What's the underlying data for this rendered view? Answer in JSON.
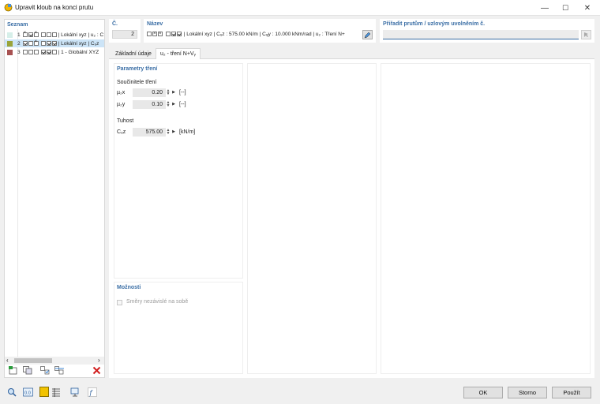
{
  "window": {
    "title": "Upravit kloub na konci prutu",
    "min": "—",
    "max": "☐",
    "close": "✕"
  },
  "list": {
    "header": "Seznam",
    "items": [
      {
        "num": "1",
        "text": "| Lokální xyz | u₂ : C",
        "color": "#d6efe9",
        "cbs": [
          "x",
          "on",
          "x",
          "off",
          "off",
          "off"
        ]
      },
      {
        "num": "2",
        "text": "| Lokální xyz | Cᵤz",
        "color": "#9aa43a",
        "cbs": [
          "on",
          "off",
          "x",
          "off",
          "on",
          "on"
        ]
      },
      {
        "num": "3",
        "text": "| 1 - Globální XYZ",
        "color": "#a85252",
        "cbs": [
          "off",
          "off",
          "off",
          "on",
          "on",
          "off"
        ]
      }
    ],
    "scroll_left": "‹",
    "scroll_right": "›"
  },
  "num_field": {
    "label": "Č.",
    "value": "2"
  },
  "name_field": {
    "label": "Název",
    "value": "| Lokální xyz | Cᵤz : 575.00 kN/m | Cᵩy : 10.000 kNm/rad | u₂ : Tření N+"
  },
  "assign_field": {
    "label": "Přiřadit prutům / uzlovým uvolněním č.",
    "value": ""
  },
  "tabs": [
    {
      "label": "Základní údaje"
    },
    {
      "label": "u₂ - tření N+Vᵧ"
    }
  ],
  "params": {
    "header": "Parametry tření",
    "friction_group": "Součinitele tření",
    "friction": [
      {
        "label": "µ₂x",
        "value": "0.20",
        "unit": "[--]"
      },
      {
        "label": "µ₂y",
        "value": "0.10",
        "unit": "[--]"
      }
    ],
    "stiffness_group": "Tuhost",
    "stiffness": [
      {
        "label": "Cᵤz",
        "value": "575.00",
        "unit": "[kN/m]"
      }
    ]
  },
  "options": {
    "header": "Možnosti",
    "independent_directions": "Směry nezávislé na sobě"
  },
  "buttons": {
    "ok": "OK",
    "cancel": "Storno",
    "apply": "Použít"
  }
}
